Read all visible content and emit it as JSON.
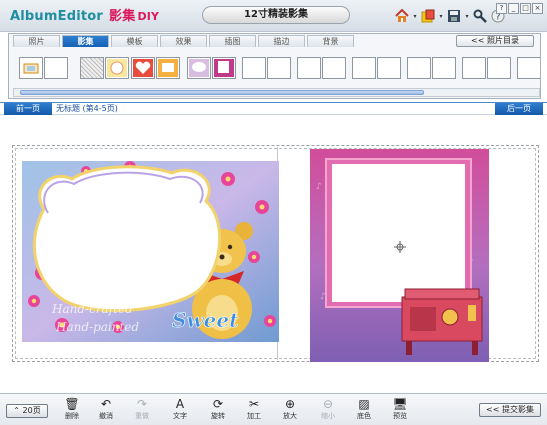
{
  "app": {
    "logo_text": "AlbumEditor",
    "logo_cn": "影集",
    "logo_diy": "DIY",
    "document_title": "12寸精装影集"
  },
  "toolbar_icons": [
    {
      "name": "home-icon",
      "glyph": "🏠",
      "has_dropdown": true
    },
    {
      "name": "import-icon",
      "glyph": "📥",
      "has_dropdown": true
    },
    {
      "name": "save-icon",
      "glyph": "💾",
      "has_dropdown": true
    },
    {
      "name": "tools-icon",
      "glyph": "🔧",
      "has_dropdown": false
    },
    {
      "name": "help-icon",
      "glyph": "?",
      "has_dropdown": false
    }
  ],
  "window_buttons": [
    "—",
    "□",
    "▫",
    "×"
  ],
  "tabs": [
    {
      "label": "照片",
      "active": false
    },
    {
      "label": "影集",
      "active": true
    },
    {
      "label": "模板",
      "active": false
    },
    {
      "label": "效果",
      "active": false
    },
    {
      "label": "插图",
      "active": false
    },
    {
      "label": "描边",
      "active": false
    },
    {
      "label": "背景",
      "active": false
    }
  ],
  "photo_directory_label": "<< 照片目录",
  "page_nav": {
    "prev_label": "前一页",
    "next_label": "后一页",
    "page_title": "无标题 (第4-5页)"
  },
  "bottom": {
    "page_count_label": "20页",
    "submit_label": "<< 提交影集",
    "tools": [
      {
        "label": "删除",
        "icon": "trash-icon",
        "glyph": "🗑",
        "enabled": true
      },
      {
        "label": "撤消",
        "icon": "undo-icon",
        "glyph": "↶",
        "enabled": true
      },
      {
        "label": "重做",
        "icon": "redo-icon",
        "glyph": "↷",
        "enabled": false
      },
      {
        "label": "文字",
        "icon": "text-icon",
        "glyph": "A",
        "enabled": true
      },
      {
        "label": "旋转",
        "icon": "rotate-icon",
        "glyph": "⟳",
        "enabled": true
      },
      {
        "label": "加工",
        "icon": "scissors-icon",
        "glyph": "✂",
        "enabled": true
      },
      {
        "label": "放大",
        "icon": "zoom-in-icon",
        "glyph": "⊕",
        "enabled": true
      },
      {
        "label": "缩小",
        "icon": "zoom-out-icon",
        "glyph": "⊖",
        "enabled": false
      },
      {
        "label": "底色",
        "icon": "background-color-icon",
        "glyph": "▨",
        "enabled": true
      },
      {
        "label": "预览",
        "icon": "preview-icon",
        "glyph": "🖥",
        "enabled": true
      }
    ]
  },
  "colors": {
    "accent_blue": "#1d6fc6",
    "logo_teal": "#1e8ea0",
    "logo_pink": "#d9195c"
  }
}
